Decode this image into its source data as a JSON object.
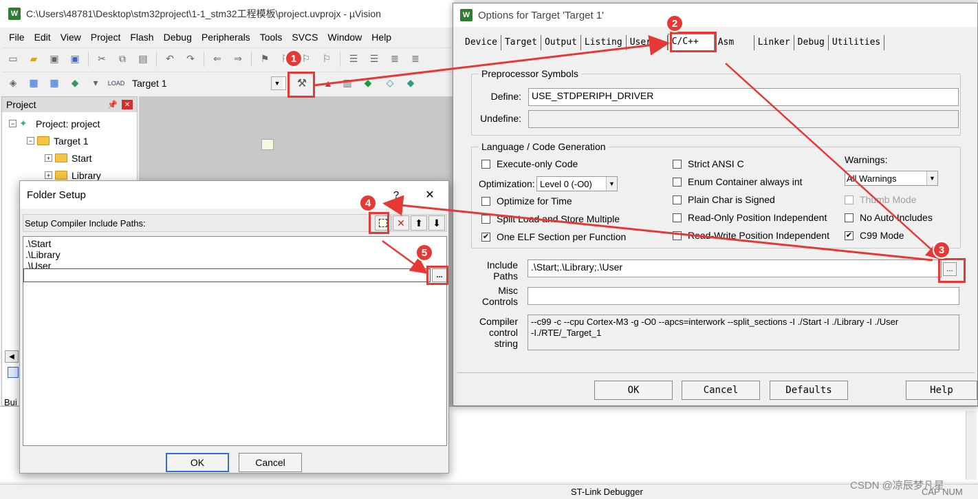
{
  "main_window": {
    "title": "C:\\Users\\48781\\Desktop\\stm32project\\1-1_stm32工程模板\\project.uvprojx - µVision",
    "menu": [
      "File",
      "Edit",
      "View",
      "Project",
      "Flash",
      "Debug",
      "Peripherals",
      "Tools",
      "SVCS",
      "Window",
      "Help"
    ],
    "target_select": "Target 1",
    "project_panel": {
      "title": "Project",
      "tree": [
        {
          "label": "Project: project",
          "level": 0
        },
        {
          "label": "Target 1",
          "level": 1
        },
        {
          "label": "Start",
          "level": 2
        },
        {
          "label": "Library",
          "level": 2
        }
      ]
    },
    "build_tab": "Bui",
    "status_debugger": "ST-Link Debugger",
    "status_caps": "CAP NUM"
  },
  "options_dialog": {
    "title": "Options for Target 'Target 1'",
    "tabs": [
      "Device",
      "Target",
      "Output",
      "Listing",
      "User",
      "C/C++",
      "Asm",
      "Linker",
      "Debug",
      "Utilities"
    ],
    "active_tab": "C/C++",
    "preprocessor": {
      "group_label": "Preprocessor Symbols",
      "define_label": "Define:",
      "define_value": "USE_STDPERIPH_DRIVER",
      "undefine_label": "Undefine:",
      "undefine_value": ""
    },
    "language": {
      "group_label": "Language / Code Generation",
      "execute_only": "Execute-only Code",
      "optimization_label": "Optimization:",
      "optimization_value": "Level 0 (-O0)",
      "optimize_time": "Optimize for Time",
      "split_load": "Split Load and Store Multiple",
      "one_elf": "One ELF Section per Function",
      "strict_ansi": "Strict ANSI C",
      "enum_container": "Enum Container always int",
      "plain_char": "Plain Char is Signed",
      "ro_pi": "Read-Only Position Independent",
      "rw_pi": "Read-Write Position Independent",
      "warnings_label": "Warnings:",
      "warnings_value": "All Warnings",
      "thumb_mode": "Thumb Mode",
      "no_auto_includes": "No Auto Includes",
      "c99_mode": "C99 Mode"
    },
    "include_paths_label": "Include\nPaths",
    "include_paths_value": ".\\Start;.\\Library;.\\User",
    "misc_label": "Misc\nControls",
    "misc_value": "",
    "compiler_label": "Compiler\ncontrol\nstring",
    "compiler_value": "--c99 -c --cpu Cortex-M3 -g -O0 --apcs=interwork --split_sections -I ./Start -I ./Library -I ./User\n-I./RTE/_Target_1",
    "browse_label": "...",
    "buttons": {
      "ok": "OK",
      "cancel": "Cancel",
      "defaults": "Defaults",
      "help": "Help"
    }
  },
  "folder_setup": {
    "title": "Folder Setup",
    "help_glyph": "?",
    "close_glyph": "✕",
    "subtitle": "Setup Compiler Include Paths:",
    "paths": [
      ".\\Start",
      ".\\Library",
      ".\\User"
    ],
    "browse_label": "...",
    "buttons": {
      "ok": "OK",
      "cancel": "Cancel"
    }
  },
  "annotations": [
    "1",
    "2",
    "3",
    "4",
    "5"
  ],
  "watermark": "CSDN @凉辰梦凡星",
  "colors": {
    "annotation_red": "#e53935",
    "keil_green": "#2e7d32"
  }
}
